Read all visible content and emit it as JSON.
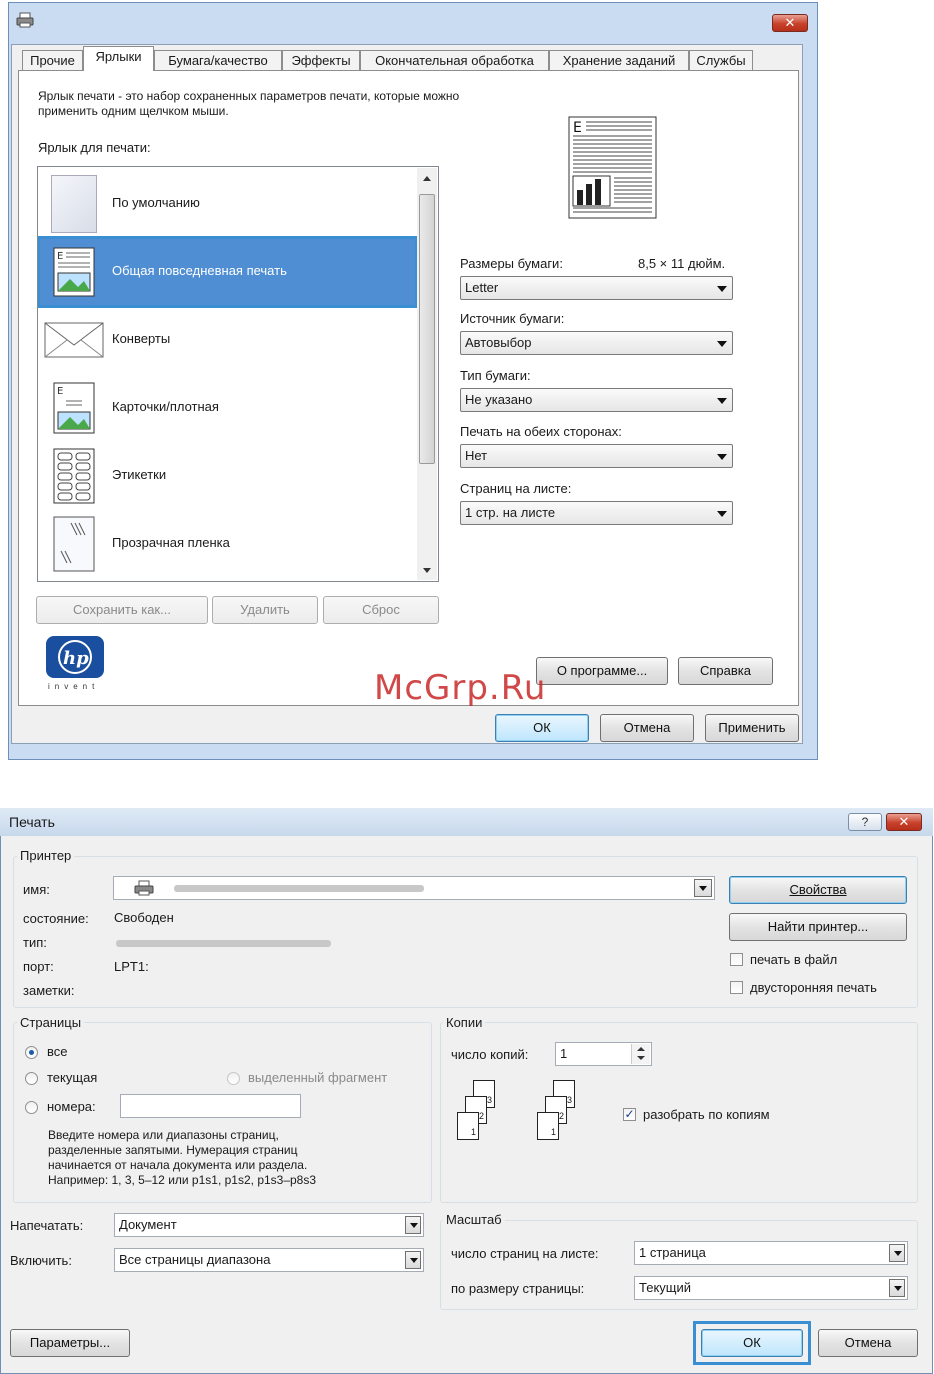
{
  "top": {
    "tabs": [
      "Прочие",
      "Ярлыки",
      "Бумага/качество",
      "Эффекты",
      "Окончательная обработка",
      "Хранение заданий",
      "Службы"
    ],
    "description": "Ярлык печати - это набор сохраненных параметров печати, которые можно применить одним щелчком мыши.",
    "shortcut_label": "Ярлык для печати:",
    "shortcuts": [
      "По умолчанию",
      "Общая повседневная печать",
      "Конверты",
      "Карточки/плотная",
      "Этикетки",
      "Прозрачная пленка"
    ],
    "paper_size_label": "Размеры бумаги:",
    "paper_size_value": "8,5 × 11 дюйм.",
    "paper_size_select": "Letter",
    "paper_source_label": "Источник бумаги:",
    "paper_source_select": "Автовыбор",
    "paper_type_label": "Тип бумаги:",
    "paper_type_select": "Не указано",
    "duplex_label": "Печать на обеих сторонах:",
    "duplex_select": "Нет",
    "pages_per_sheet_label": "Страниц на листе:",
    "pages_per_sheet_select": "1 стр. на листе",
    "save_as": "Сохранить как...",
    "delete": "Удалить",
    "reset": "Сброс",
    "logo_text": "invent",
    "about": "О программе...",
    "help": "Справка",
    "ok": "ОК",
    "cancel": "Отмена",
    "apply": "Применить",
    "watermark": "McGrp.Ru"
  },
  "bottom": {
    "title": "Печать",
    "printer_group": "Принтер",
    "name_label": "имя:",
    "status_label": "состояние:",
    "status_value": "Свободен",
    "type_label": "тип:",
    "port_label": "порт:",
    "port_value": "LPT1:",
    "notes_label": "заметки:",
    "properties": "Свойства",
    "find_printer": "Найти принтер...",
    "print_to_file": "печать в файл",
    "duplex": "двусторонняя печать",
    "pages_group": "Страницы",
    "all": "все",
    "current": "текущая",
    "selection": "выделенный фрагмент",
    "pages": "номера:",
    "pages_hint": [
      "Введите номера или диапазоны страниц,",
      "разделенные запятыми. Нумерация страниц",
      "начинается от начала документа или раздела.",
      "Например: 1, 3, 5–12 или p1s1, p1s2, p1s3–p8s3"
    ],
    "copies_group": "Копии",
    "copies_label": "число копий:",
    "copies_value": "1",
    "collate": "разобрать по копиям",
    "print_what_label": "Напечатать:",
    "print_what_value": "Документ",
    "include_label": "Включить:",
    "include_value": "Все страницы диапазона",
    "zoom_group": "Масштаб",
    "pages_per_sheet_label": "число страниц на листе:",
    "pages_per_sheet_value": "1 страница",
    "scale_label": "по размеру страницы:",
    "scale_value": "Текущий",
    "options": "Параметры...",
    "ok": "ОК",
    "cancel": "Отмена",
    "page_nums": [
      "1",
      "2",
      "3"
    ]
  }
}
